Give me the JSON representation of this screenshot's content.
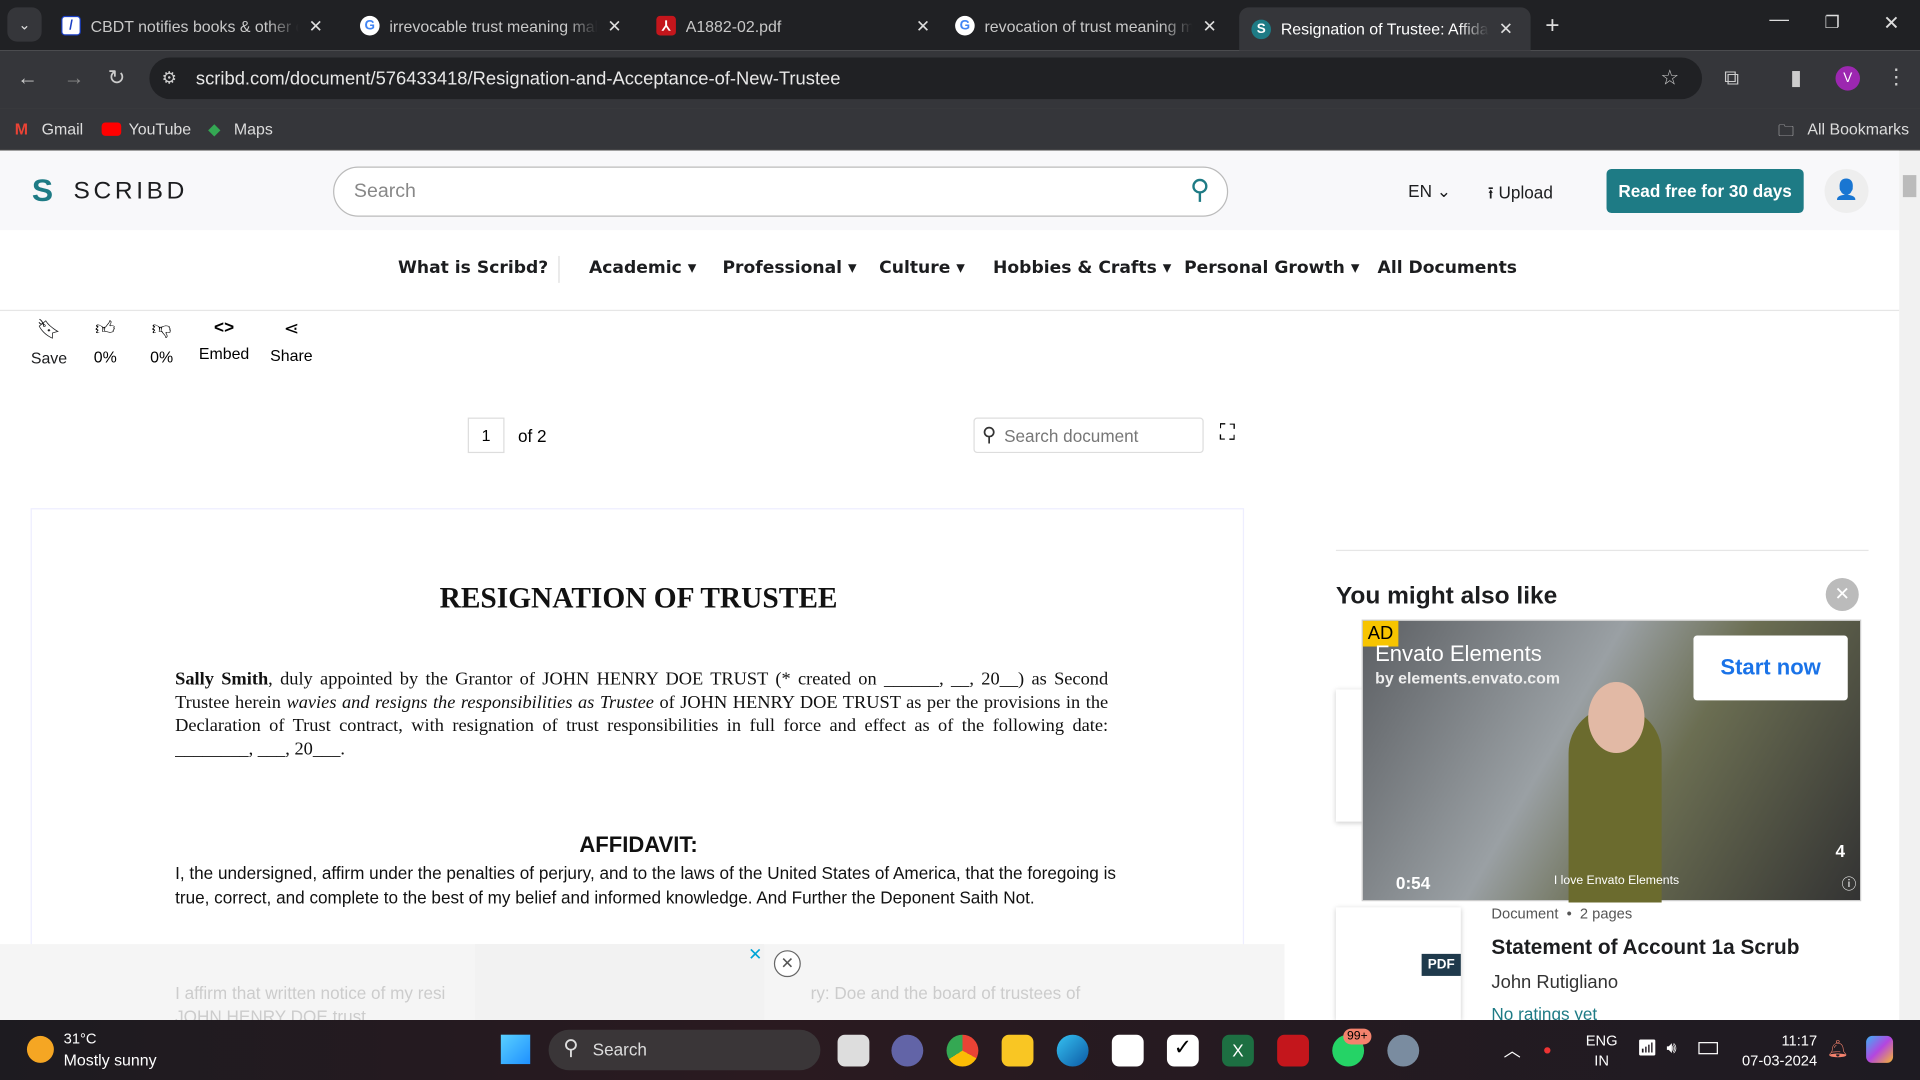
{
  "browser": {
    "tabs": [
      {
        "title": "CBDT notifies books & other do",
        "icon": "taxmann-icon"
      },
      {
        "title": "irrevocable trust meaning malay",
        "icon": "google-icon"
      },
      {
        "title": "A1882-02.pdf",
        "icon": "pdf-icon"
      },
      {
        "title": "revocation of trust meaning ma",
        "icon": "google-icon"
      },
      {
        "title": "Resignation of Trustee: Affidavit",
        "icon": "scribd-icon",
        "active": true
      }
    ],
    "url": "scribd.com/document/576433418/Resignation-and-Acceptance-of-New-Trustee",
    "profile_initial": "V",
    "bookmarks": [
      "Gmail",
      "YouTube",
      "Maps"
    ],
    "all_bookmarks": "All Bookmarks"
  },
  "header": {
    "logo": "SCRIBD",
    "search_placeholder": "Search",
    "lang": "EN",
    "upload": "Upload",
    "cta": "Read free for 30 days",
    "accent": "#1e7b85"
  },
  "nav": [
    "What is Scribd?",
    "Academic",
    "Professional",
    "Culture",
    "Hobbies & Crafts",
    "Personal Growth",
    "All Documents"
  ],
  "actions": [
    {
      "label": "Save",
      "icon": "bookmark-icon"
    },
    {
      "label": "0%",
      "icon": "thumbs-up-icon"
    },
    {
      "label": "0%",
      "icon": "thumbs-down-icon"
    },
    {
      "label": "Embed",
      "icon": "code-icon"
    },
    {
      "label": "Share",
      "icon": "share-icon"
    }
  ],
  "pager": {
    "current": "1",
    "total": "of 2",
    "search_placeholder": "Search document"
  },
  "document": {
    "title": "RESIGNATION OF TRUSTEE",
    "p1_name": "Sally Smith",
    "p1_a": ", duly appointed by the Grantor of JOHN HENRY DOE TRUST (* created on ______, __, 20__) as Second Trustee herein ",
    "p1_italic": "wavies and resigns the responsibilities as Trustee",
    "p1_b": " of JOHN HENRY DOE TRUST as per the provisions in the Declaration of Trust contract, with resignation of trust responsibilities in full force and effect as of the following date: ________, ___, 20___.",
    "affidavit_heading": "AFFIDAVIT:",
    "affidavit_text": "I, the undersigned, affirm under the penalties of perjury, and to the laws of the United States of America, that the foregoing is true, correct, and complete to the best of my belief and informed knowledge. And Further the Deponent Saith Not.",
    "faded_a": "I affirm that written notice of my resi",
    "faded_b": "ry: Doe and the board of trustees of",
    "faded_c": "JOHN HENRY DOE trust."
  },
  "sidebar": {
    "heading": "You might also like",
    "ad": {
      "badge": "AD",
      "title": "Envato Elements",
      "subtitle": "by elements.envato.com",
      "cta": "Start now",
      "time": "0:54",
      "caption": "I love Envato Elements",
      "count": "4"
    },
    "item": {
      "type": "Document",
      "pages": "2 pages",
      "title": "Statement of Account 1a Scrub",
      "author": "John Rutigliano",
      "rating": "No ratings yet",
      "badge": "PDF"
    }
  },
  "taskbar": {
    "temp": "31°C",
    "weather": "Mostly sunny",
    "search": "Search",
    "badge": "99+",
    "lang1": "ENG",
    "lang2": "IN",
    "time": "11:17",
    "date": "07-03-2024"
  }
}
